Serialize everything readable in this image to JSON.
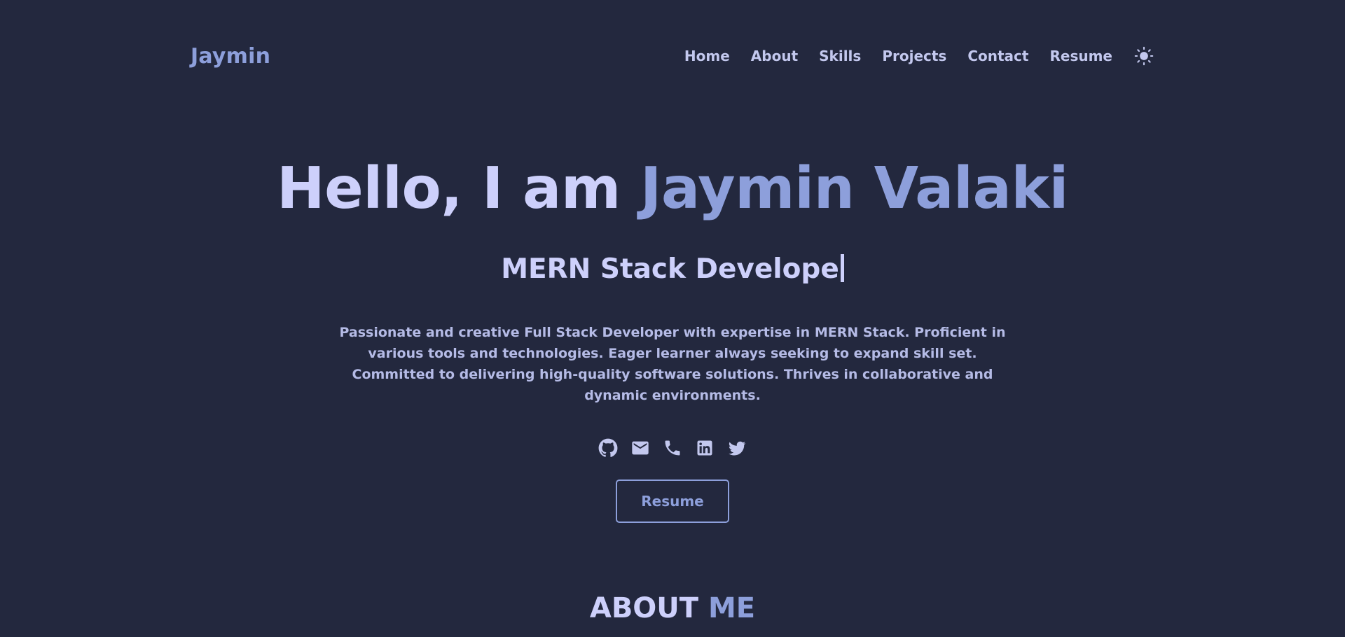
{
  "header": {
    "logo": "Jaymin",
    "nav": [
      {
        "label": "Home"
      },
      {
        "label": "About"
      },
      {
        "label": "Skills"
      },
      {
        "label": "Projects"
      },
      {
        "label": "Contact"
      },
      {
        "label": "Resume"
      }
    ],
    "theme_icon": "sun-icon"
  },
  "hero": {
    "greeting": "Hello, I am ",
    "name": "Jaymin Valaki",
    "typed_role": "MERN Stack Develope",
    "description": "Passionate and creative Full Stack Developer with expertise in MERN Stack. Proficient in various tools and technologies. Eager learner always seeking to expand skill set. Committed to delivering high-quality software solutions. Thrives in collaborative and dynamic environments.",
    "socials": [
      {
        "icon": "github-icon"
      },
      {
        "icon": "email-icon"
      },
      {
        "icon": "phone-icon"
      },
      {
        "icon": "linkedin-icon"
      },
      {
        "icon": "twitter-icon"
      }
    ],
    "resume_button": "Resume"
  },
  "about": {
    "heading_main": "ABOUT ",
    "heading_accent": "ME"
  },
  "colors": {
    "background": "#23283e",
    "accent": "#8d9fdb",
    "text": "#cdd0fb"
  }
}
